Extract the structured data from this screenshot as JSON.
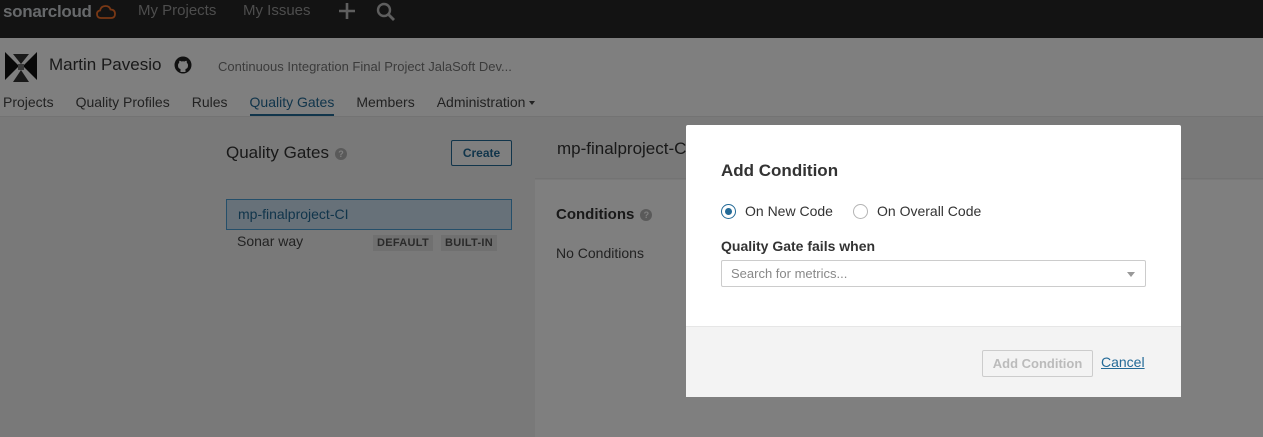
{
  "topbar": {
    "logo_text": "sonarcloud",
    "nav": [
      "My Projects",
      "My Issues"
    ],
    "plus_icon": "plus-icon",
    "search_icon": "search-icon"
  },
  "org": {
    "name": "Martin Pavesio",
    "description": "Continuous Integration Final Project JalaSoft Dev...",
    "nav": [
      "Projects",
      "Quality Profiles",
      "Rules",
      "Quality Gates",
      "Members",
      "Administration"
    ],
    "active_nav": "Quality Gates"
  },
  "gates": {
    "title": "Quality Gates",
    "create_label": "Create",
    "items": [
      {
        "name": "mp-finalproject-CI",
        "selected": true,
        "badges": []
      },
      {
        "name": "Sonar way",
        "selected": false,
        "badges": [
          "DEFAULT",
          "BUILT-IN"
        ]
      }
    ]
  },
  "detail": {
    "title": "mp-finalproject-CI",
    "conditions_title": "Conditions",
    "no_conditions": "No Conditions"
  },
  "modal": {
    "title": "Add Condition",
    "radio_new": "On New Code",
    "radio_overall": "On Overall Code",
    "selected_radio": "On New Code",
    "fails_label": "Quality Gate fails when",
    "search_placeholder": "Search for metrics...",
    "add_label": "Add Condition",
    "cancel_label": "Cancel"
  },
  "colors": {
    "accent": "#236a97",
    "topbar_bg": "#262626",
    "overlay": "rgba(0,0,0,0.5)"
  }
}
